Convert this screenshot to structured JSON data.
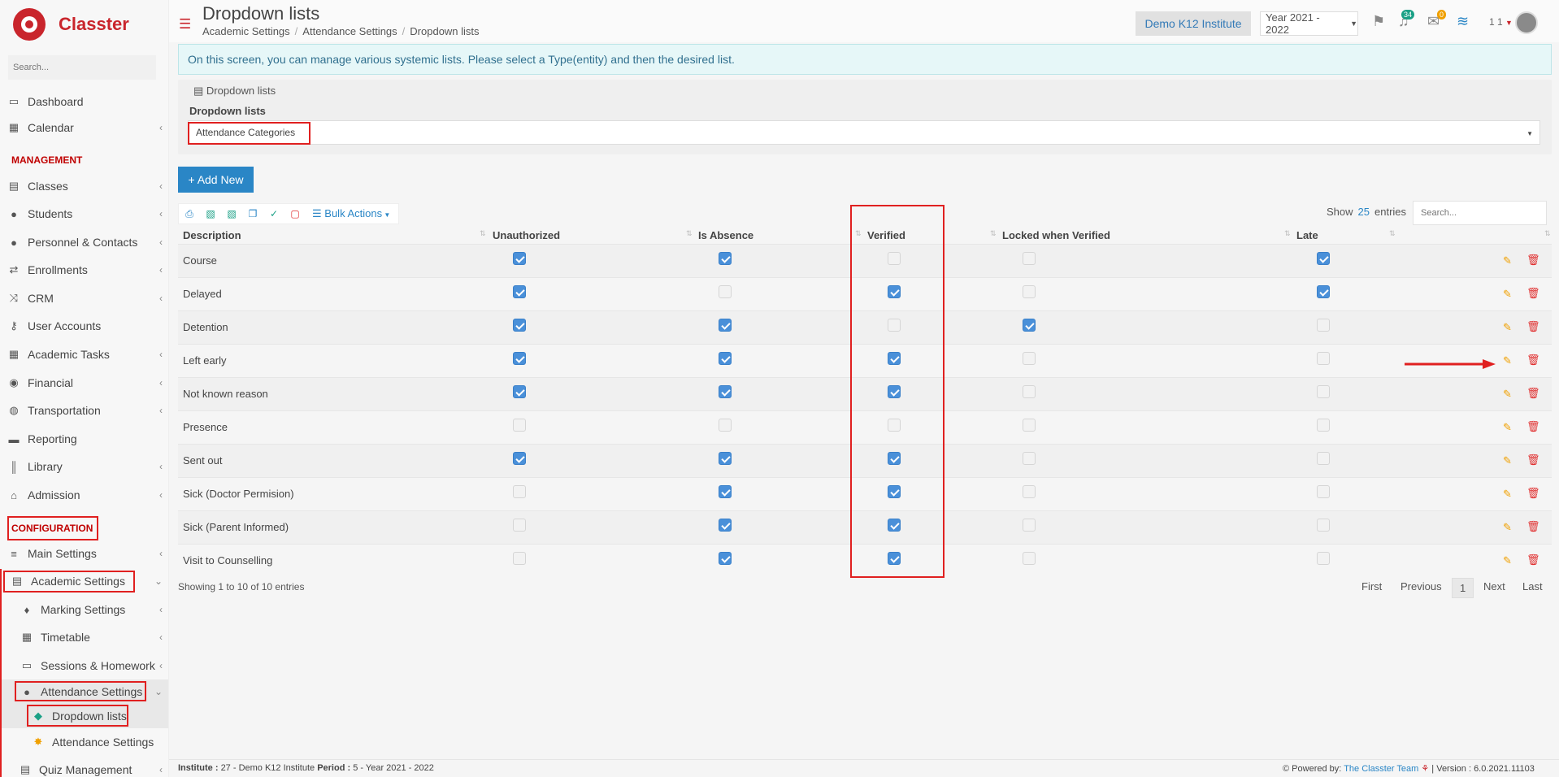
{
  "app": {
    "name": "Classter",
    "search_placeholder": "Search..."
  },
  "sidebar": {
    "items": [
      {
        "label": "Dashboard",
        "icon": "laptop-icon"
      },
      {
        "label": "Calendar",
        "icon": "calendar-icon"
      },
      {
        "label": "Classes",
        "icon": "classes-icon"
      },
      {
        "label": "Students",
        "icon": "students-icon"
      },
      {
        "label": "Personnel & Contacts",
        "icon": "person-icon"
      },
      {
        "label": "Enrollments",
        "icon": "exchange-icon"
      },
      {
        "label": "CRM",
        "icon": "shuffle-icon"
      },
      {
        "label": "User Accounts",
        "icon": "key-icon"
      },
      {
        "label": "Academic Tasks",
        "icon": "grid-icon"
      },
      {
        "label": "Financial",
        "icon": "coins-icon"
      },
      {
        "label": "Transportation",
        "icon": "bus-icon"
      },
      {
        "label": "Reporting",
        "icon": "printer-icon"
      },
      {
        "label": "Library",
        "icon": "books-icon"
      },
      {
        "label": "Admission",
        "icon": "building-icon"
      }
    ],
    "management_title": "MANAGEMENT",
    "configuration_title": "CONFIGURATION",
    "config_items": [
      {
        "label": "Main Settings"
      },
      {
        "label": "Academic Settings"
      },
      {
        "label": "Marking Settings"
      },
      {
        "label": "Timetable"
      },
      {
        "label": "Sessions & Homework"
      },
      {
        "label": "Attendance Settings"
      },
      {
        "label": "Dropdown lists"
      },
      {
        "label": "Attendance Settings"
      },
      {
        "label": "Quiz Management"
      }
    ]
  },
  "header": {
    "title": "Dropdown lists",
    "breadcrumb": [
      "Academic Settings",
      "Attendance Settings",
      "Dropdown lists"
    ],
    "institute": "Demo K12 Institute",
    "year": "Year 2021 - 2022",
    "notifications_count": "34",
    "messages_count": "0",
    "user_short": "1 1"
  },
  "info_text": "On this screen, you can manage various systemic lists. Please select a Type(entity) and then the desired list.",
  "panel": {
    "legend": "Dropdown lists",
    "label": "Dropdown lists",
    "selected": "Attendance Categories"
  },
  "add_new_label": "Add New",
  "bulk_actions_label": "Bulk Actions",
  "show_label": "Show",
  "show_count": "25",
  "entries_label": "entries",
  "table_search_placeholder": "Search...",
  "table": {
    "columns": [
      "Description",
      "Unauthorized",
      "Is Absence",
      "Verified",
      "Locked when Verified",
      "Late"
    ],
    "rows": [
      {
        "desc": "Course",
        "vals": [
          true,
          true,
          false,
          false,
          true
        ]
      },
      {
        "desc": "Delayed",
        "vals": [
          true,
          false,
          true,
          false,
          true
        ]
      },
      {
        "desc": "Detention",
        "vals": [
          true,
          true,
          false,
          true,
          false
        ]
      },
      {
        "desc": "Left early",
        "vals": [
          true,
          true,
          true,
          false,
          false
        ]
      },
      {
        "desc": "Not known reason",
        "vals": [
          true,
          true,
          true,
          false,
          false
        ]
      },
      {
        "desc": "Presence",
        "vals": [
          false,
          false,
          false,
          false,
          false
        ]
      },
      {
        "desc": "Sent out",
        "vals": [
          true,
          true,
          true,
          false,
          false
        ]
      },
      {
        "desc": "Sick (Doctor Permision)",
        "vals": [
          false,
          true,
          true,
          false,
          false
        ]
      },
      {
        "desc": "Sick (Parent Informed)",
        "vals": [
          false,
          true,
          true,
          false,
          false
        ]
      },
      {
        "desc": "Visit to Counselling",
        "vals": [
          false,
          true,
          true,
          false,
          false
        ]
      }
    ]
  },
  "showing_text": "Showing 1 to 10 of 10 entries",
  "pagination": {
    "first": "First",
    "previous": "Previous",
    "current": "1",
    "next": "Next",
    "last": "Last"
  },
  "footer": {
    "institute_label": "Institute :",
    "institute_value": "27 - Demo K12 Institute",
    "period_label": "Period :",
    "period_value": "5 - Year 2021 - 2022",
    "powered_label": "Powered by:",
    "powered_link": "The Classter Team",
    "version": "| Version : 6.0.2021.11103"
  },
  "colors": {
    "brand": "#c9252c",
    "primary": "#2a86c6",
    "highlight": "#e02020"
  }
}
